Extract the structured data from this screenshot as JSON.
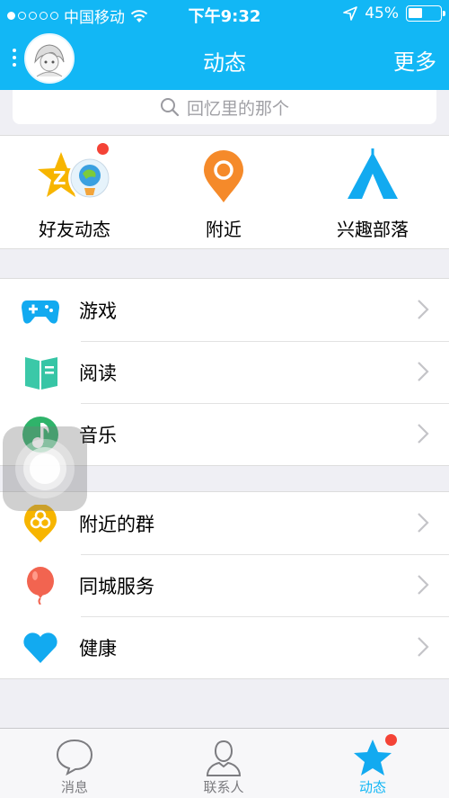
{
  "status_bar": {
    "carrier": "中国移动",
    "time": "下午9:32",
    "battery": "45%",
    "battery_level": 0.45
  },
  "nav": {
    "title": "动态",
    "more_label": "更多"
  },
  "search": {
    "placeholder": "回忆里的那个"
  },
  "quick_items": [
    {
      "label": "好友动态",
      "icon": "friend-feed-icon",
      "badge": true
    },
    {
      "label": "附近",
      "icon": "location-pin-icon"
    },
    {
      "label": "兴趣部落",
      "icon": "tent-icon"
    }
  ],
  "group1": [
    {
      "label": "游戏",
      "icon": "gamepad-icon"
    },
    {
      "label": "阅读",
      "icon": "book-icon"
    },
    {
      "label": "音乐",
      "icon": "music-icon"
    }
  ],
  "group2": [
    {
      "label": "附近的群",
      "icon": "nearby-group-icon"
    },
    {
      "label": "同城服务",
      "icon": "balloon-icon"
    },
    {
      "label": "健康",
      "icon": "heart-icon"
    }
  ],
  "tabs": [
    {
      "label": "消息",
      "icon": "message-bubble-icon"
    },
    {
      "label": "联系人",
      "icon": "contact-person-icon"
    },
    {
      "label": "动态",
      "icon": "star-icon",
      "active": true
    }
  ],
  "colors": {
    "brand": "#12b7f5",
    "badge": "#f44336"
  }
}
